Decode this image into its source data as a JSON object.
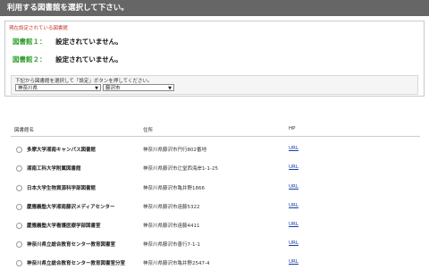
{
  "header": {
    "title": "利用する図書館を選択して下さい。"
  },
  "current": {
    "title": "現在設定されている図書館",
    "library1": {
      "label": "図書館１：",
      "value": "設定されていません。"
    },
    "library2": {
      "label": "図書館２：",
      "value": "設定されていません。"
    }
  },
  "selector": {
    "instruction": "下記から図書館を選択して「設定」ボタンを押してください。",
    "prefecture": "神奈川県",
    "city": "藤沢市"
  },
  "list": {
    "headers": {
      "name": "図書館名",
      "address": "住所",
      "hp": "HP"
    },
    "rows": [
      {
        "name": "多摩大学湘南キャンパス図書館",
        "address": "神奈川県藤沢市円行802番地",
        "hp": "URL"
      },
      {
        "name": "湘南工科大学附属図書館",
        "address": "神奈川県藤沢市辻堂西海岸1-1-25",
        "hp": "URL"
      },
      {
        "name": "日本大学生物資源科学部図書館",
        "address": "神奈川県藤沢市亀井野1866",
        "hp": "URL"
      },
      {
        "name": "慶應義塾大学湘南藤沢メディアセンター",
        "address": "神奈川県藤沢市遠藤5322",
        "hp": "URL"
      },
      {
        "name": "慶應義塾大学看護医療学部図書室",
        "address": "神奈川県藤沢市遠藤4411",
        "hp": "URL"
      },
      {
        "name": "神奈川県立総合教育センター教育図書室",
        "address": "神奈川県藤沢市善行7-1-1",
        "hp": "URL"
      },
      {
        "name": "神奈川県立総合教育センター教育図書室分室",
        "address": "神奈川県藤沢市亀井野2547-4",
        "hp": "URL"
      }
    ]
  }
}
